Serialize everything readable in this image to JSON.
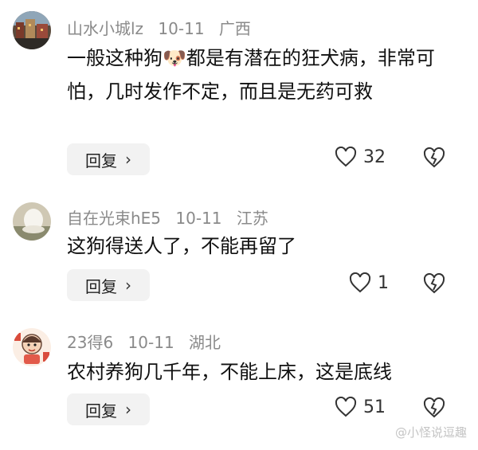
{
  "comments": [
    {
      "username": "山水小城lz",
      "date": "10-11",
      "location": "广西",
      "text": "一般这种狗🐶都是有潜在的狂犬病，非常可怕，几时发作不定，而且是无药可救",
      "reply_label": "回复",
      "likes": "32",
      "avatar_icon": "cityscape-avatar"
    },
    {
      "username": "自在光束hE5",
      "date": "10-11",
      "location": "江苏",
      "text": "这狗得送人了，不能再留了",
      "reply_label": "回复",
      "likes": "1",
      "avatar_icon": "white-object-avatar"
    },
    {
      "username": "23得6",
      "date": "10-11",
      "location": "湖北",
      "text": "农村养狗几千年，不能上床，这是底线",
      "reply_label": "回复",
      "likes": "51",
      "avatar_icon": "cartoon-character-avatar"
    }
  ],
  "watermark": "@小怪说逗趣",
  "colors": {
    "meta": "#8a8a8a",
    "reply_bg": "#f2f2f2",
    "text": "#111111"
  }
}
